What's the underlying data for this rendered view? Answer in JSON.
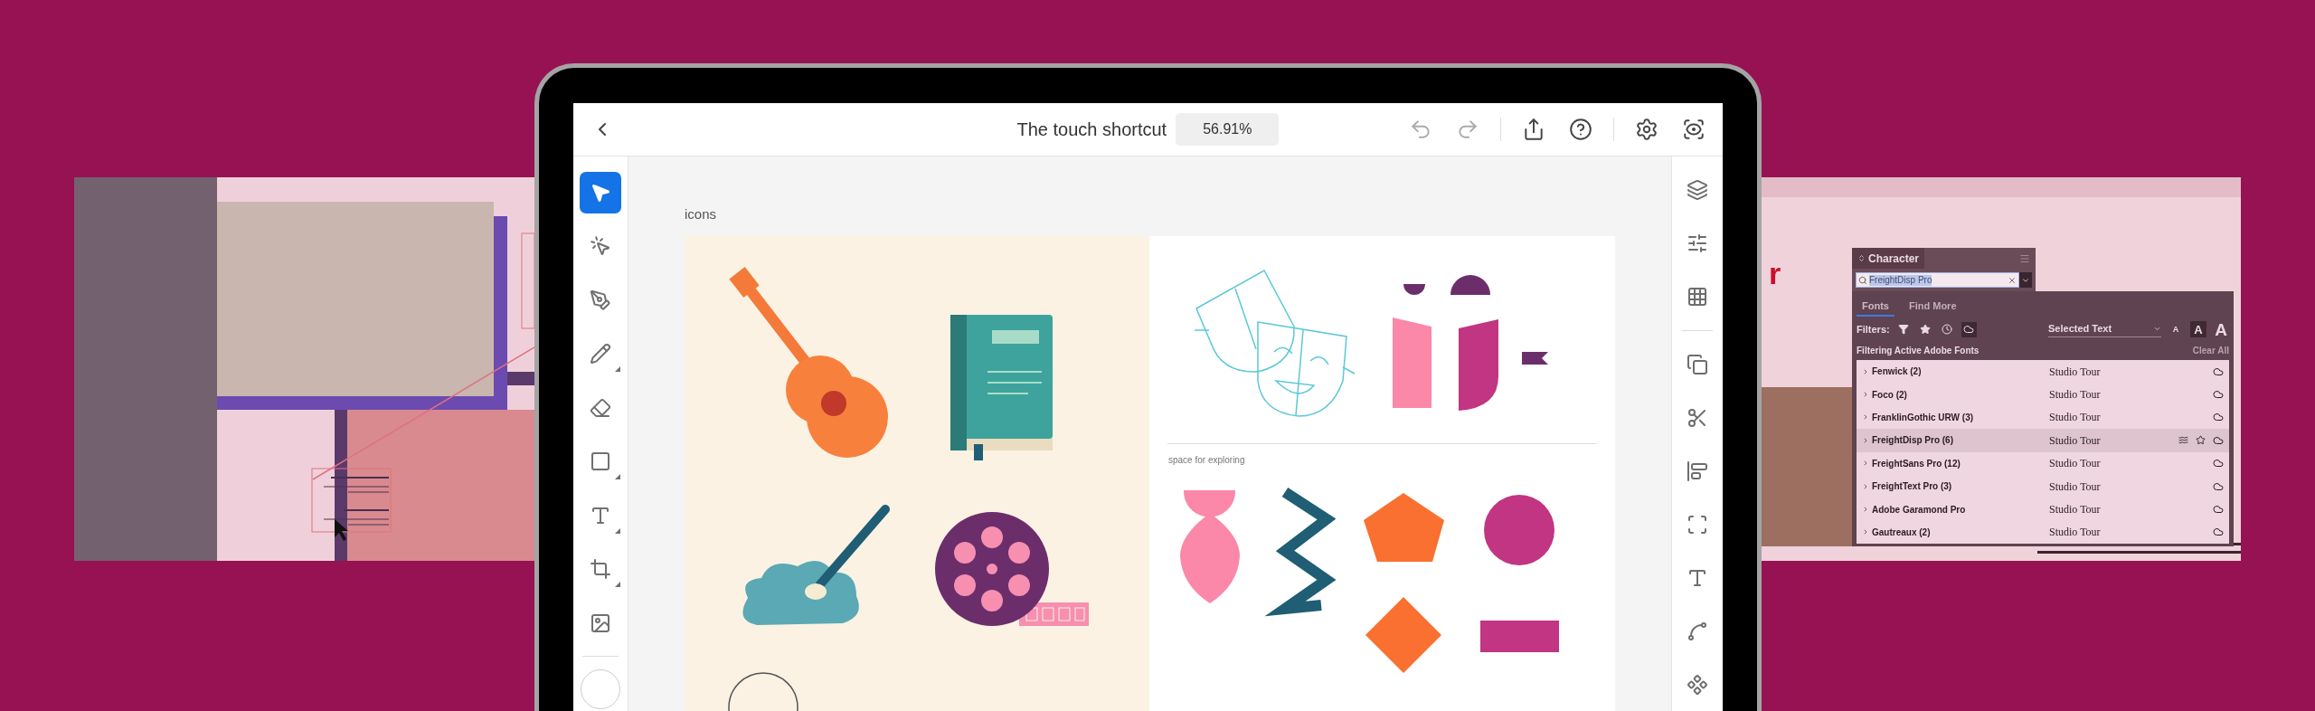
{
  "left_document": {
    "kind": "layout"
  },
  "tablet": {
    "top_bar": {
      "title": "The touch shortcut",
      "zoom": "56.91%",
      "actions": [
        {
          "kind": "undo",
          "disabled": true
        },
        {
          "kind": "redo",
          "disabled": true
        },
        {
          "kind": "divider"
        },
        {
          "kind": "share",
          "disabled": false
        },
        {
          "kind": "help",
          "disabled": false
        },
        {
          "kind": "divider"
        },
        {
          "kind": "settings",
          "disabled": false
        },
        {
          "kind": "preview",
          "disabled": false
        }
      ]
    },
    "tools": [
      {
        "kind": "select",
        "selected": true,
        "flyout": false
      },
      {
        "kind": "direct-select",
        "selected": false,
        "flyout": false
      },
      {
        "kind": "pen",
        "selected": false,
        "flyout": false
      },
      {
        "kind": "pencil",
        "selected": false,
        "flyout": true
      },
      {
        "kind": "eraser",
        "selected": false,
        "flyout": false
      },
      {
        "kind": "rectangle",
        "selected": false,
        "flyout": true
      },
      {
        "kind": "text",
        "selected": false,
        "flyout": true
      },
      {
        "kind": "artboard",
        "selected": false,
        "flyout": true
      },
      {
        "kind": "image",
        "selected": false,
        "flyout": false
      }
    ],
    "panels": [
      {
        "kind": "layers"
      },
      {
        "kind": "properties"
      },
      {
        "kind": "grid"
      },
      {
        "kind": "divider"
      },
      {
        "kind": "combine"
      },
      {
        "kind": "cut"
      },
      {
        "kind": "align"
      },
      {
        "kind": "frame"
      },
      {
        "kind": "text"
      },
      {
        "kind": "path"
      },
      {
        "kind": "component"
      }
    ],
    "canvas": {
      "artboard_label": "icons",
      "section_label": "space for exploring"
    }
  },
  "right_document": {
    "letter": "r",
    "character_panel": {
      "title": "Character",
      "search": "FreightDisp Pro",
      "tabs": [
        {
          "label": "Fonts",
          "selected": true
        },
        {
          "label": "Find More",
          "selected": false
        }
      ],
      "filters_label": "Filters:",
      "filters": [
        {
          "kind": "funnel",
          "selected": false
        },
        {
          "kind": "star",
          "selected": false
        },
        {
          "kind": "recent",
          "selected": false
        },
        {
          "kind": "cloud",
          "selected": true
        }
      ],
      "preview": "Selected Text",
      "sizes": [
        {
          "label": "A",
          "selected": false
        },
        {
          "label": "A",
          "selected": true
        },
        {
          "label": "A",
          "selected": false
        }
      ],
      "status": "Filtering Active Adobe Fonts",
      "clear": "Clear All",
      "fonts": [
        {
          "name": "Fenwick (2)",
          "sample": "Studio Tour",
          "selected": false
        },
        {
          "name": "Foco (2)",
          "sample": "Studio Tour",
          "selected": false
        },
        {
          "name": "FranklinGothic URW (3)",
          "sample": "Studio Tour",
          "selected": false
        },
        {
          "name": "FreightDisp Pro (6)",
          "sample": "Studio Tour",
          "selected": true
        },
        {
          "name": "FreightSans Pro (12)",
          "sample": "Studio Tour",
          "selected": false
        },
        {
          "name": "FreightText Pro (3)",
          "sample": "Studio Tour",
          "selected": false
        },
        {
          "name": "Adobe Garamond Pro",
          "sample": "Studio Tour",
          "selected": false
        },
        {
          "name": "Gautreaux (2)",
          "sample": "Studio Tour",
          "selected": false
        }
      ]
    }
  }
}
